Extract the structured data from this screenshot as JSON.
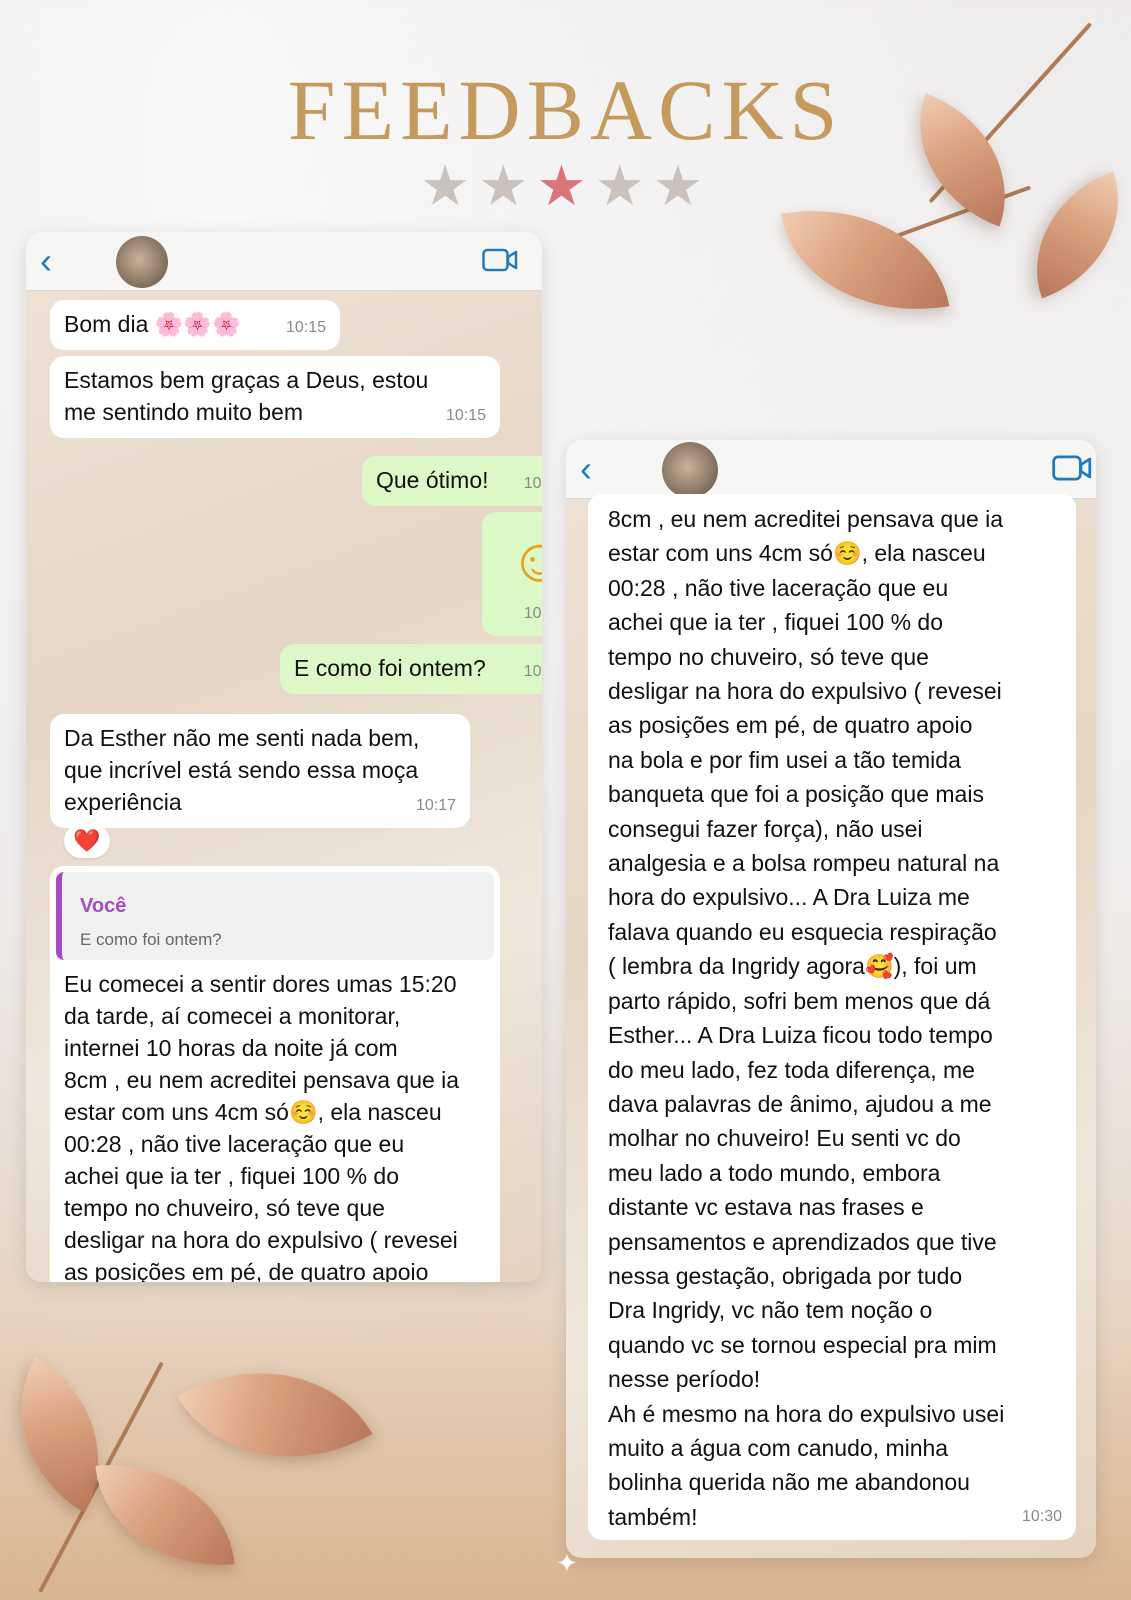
{
  "page": {
    "title": "FEEDBACKS",
    "stars": 5,
    "highlighted_star": 3,
    "colors": {
      "title": "#c59a5c",
      "star": "#c9c2bd",
      "star_active": "#d9767a",
      "outgoing_bubble": "#dcf8c6",
      "quote_accent": "#a54bc4"
    }
  },
  "left_chat": {
    "header": {
      "back_icon": "chevron-left-icon",
      "video_icon": "video-camera-icon"
    },
    "messages": [
      {
        "text": "Bom dia 🌸🌸🌸",
        "time": "10:15",
        "dir": "in"
      },
      {
        "text": "Estamos bem graças a Deus, estou\nme sentindo muito bem",
        "time": "10:15",
        "dir": "in"
      },
      {
        "text": "Que ótimo!",
        "time": "10:",
        "dir": "out"
      },
      {
        "text": "☺",
        "time": "10:",
        "dir": "out"
      },
      {
        "text": "E como foi ontem?",
        "time": "10:",
        "dir": "out"
      },
      {
        "text": "Da Esther não me senti nada bem,\nque incrível está sendo essa moça\nexperiência",
        "time": "10:17",
        "dir": "in"
      }
    ],
    "reaction": "❤️",
    "reply": {
      "quote_author": "Você",
      "quote_text": "E como foi ontem?",
      "text": "Eu comecei a sentir dores umas 15:20\nda tarde, aí comecei a monitorar,\ninternei 10 horas da noite já com\n8cm , eu nem acreditei pensava que ia\nestar com uns 4cm só☺️, ela nasceu\n00:28 , não tive laceração que eu\nachei que ia ter , fiquei 100 % do\ntempo no chuveiro, só teve que\ndesligar na hora do expulsivo ( revesei\nas posições em pé, de quatro apoio"
    }
  },
  "right_chat": {
    "header": {
      "back_icon": "chevron-left-icon",
      "video_icon": "video-camera-icon"
    },
    "message": {
      "text": "8cm , eu nem acreditei pensava que ia\nestar com uns 4cm só☺️, ela nasceu\n00:28 , não tive laceração que eu\nachei que ia ter , fiquei 100 % do\ntempo no chuveiro, só teve que\ndesligar na hora do expulsivo ( revesei\nas posições em pé, de quatro apoio\nna bola e por fim usei a tão temida\nbanqueta que foi a posição que mais\nconsegui fazer força), não usei\nanalgesia e a bolsa rompeu natural na\nhora do expulsivo... A Dra Luiza me\nfalava quando eu esquecia respiração\n( lembra da Ingridy agora🥰), foi um\nparto rápido, sofri bem menos que dá\nEsther... A Dra Luiza ficou todo tempo\ndo meu lado, fez toda diferença, me\ndava palavras de ânimo, ajudou a me\nmolhar no chuveiro! Eu senti vc do\nmeu lado a todo mundo, embora\ndistante vc estava nas frases e\npensamentos e aprendizados que tive\nnessa gestação, obrigada por tudo\nDra Ingridy, vc não tem noção o\nquando vc se tornou especial pra mim\nnesse período!\nAh é mesmo na hora do expulsivo usei\nmuito a água com canudo, minha\nbolinha querida não me abandonou\ntambém!",
      "time": "10:30"
    }
  }
}
